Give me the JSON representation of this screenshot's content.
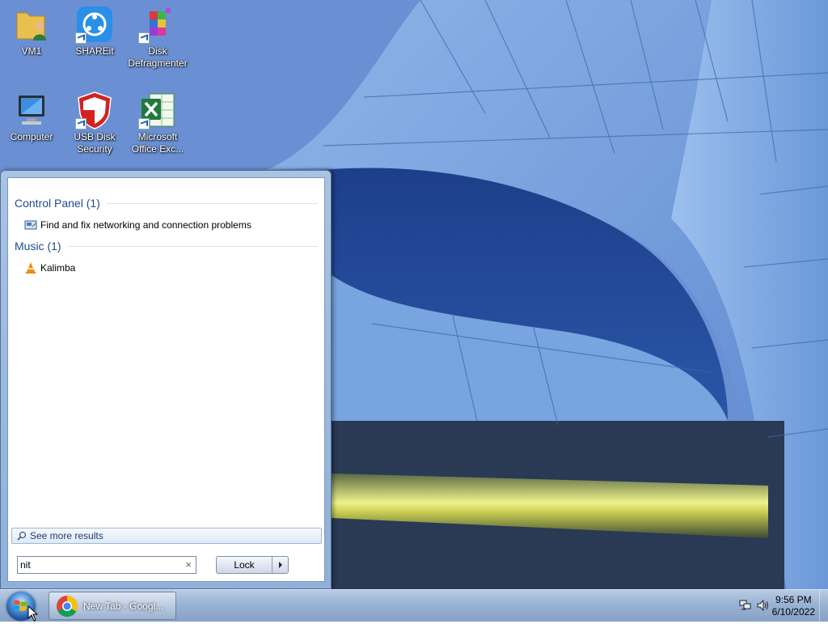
{
  "desktop": {
    "icons": [
      {
        "label": "VM1",
        "icon": "user-folder-icon"
      },
      {
        "label": "SHAREit",
        "icon": "shareit-icon",
        "shortcut": true
      },
      {
        "label": "Disk Defragmenter",
        "icon": "disk-defragmenter-icon",
        "shortcut": true
      },
      {
        "label": "Computer",
        "icon": "computer-icon"
      },
      {
        "label": "USB Disk Security",
        "icon": "shield-icon",
        "shortcut": true
      },
      {
        "label": "Microsoft Office Exc...",
        "icon": "excel-icon",
        "shortcut": true
      }
    ]
  },
  "start_menu": {
    "groups": [
      {
        "header": "Control Panel (1)",
        "items": [
          {
            "label": "Find and fix networking and connection problems",
            "icon": "network-troubleshoot-icon"
          }
        ]
      },
      {
        "header": "Music (1)",
        "items": [
          {
            "label": "Kalimba",
            "icon": "vlc-cone-icon"
          }
        ]
      }
    ],
    "see_more_label": "See more results",
    "search": {
      "value": "nit",
      "clear_glyph": "×"
    },
    "lock_button_label": "Lock"
  },
  "taskbar": {
    "buttons": [
      {
        "label": "New Tab - Googl...",
        "icon": "chrome-icon"
      }
    ],
    "clock": {
      "time": "9:56 PM",
      "date": "6/10/2022"
    }
  },
  "colors": {
    "group_header": "#1e4b8f",
    "taskbar_top": "#b8cbe3",
    "wallpaper_blue": "#3b68b8"
  }
}
